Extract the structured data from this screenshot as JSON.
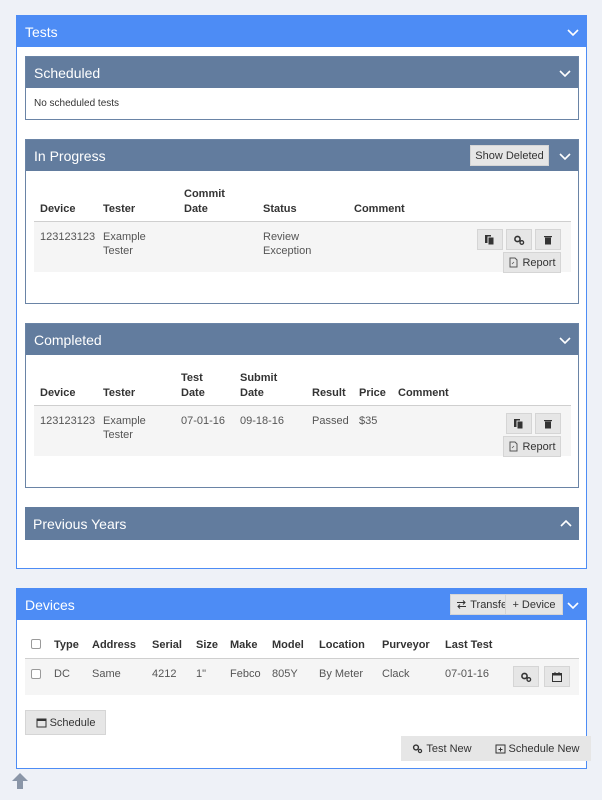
{
  "tests": {
    "title": "Tests",
    "scheduled": {
      "title": "Scheduled",
      "empty_text": "No scheduled tests"
    },
    "in_progress": {
      "title": "In Progress",
      "show_deleted_label": "Show Deleted",
      "headers": [
        "Device",
        "Tester",
        "Commit Date",
        "Status",
        "Comment"
      ],
      "header_commit_line1": "Commit",
      "header_commit_line2": "Date",
      "rows": [
        {
          "device": "123123123",
          "tester_line1": "Example",
          "tester_line2": "Tester",
          "commit_date": "",
          "status_line1": "Review",
          "status_line2": "Exception",
          "comment": "",
          "report_label": "Report"
        }
      ]
    },
    "completed": {
      "title": "Completed",
      "headers": [
        "Device",
        "Tester",
        "Test Date",
        "Submit Date",
        "Result",
        "Price",
        "Comment"
      ],
      "header_test_line1": "Test",
      "header_test_line2": "Date",
      "header_submit_line1": "Submit",
      "header_submit_line2": "Date",
      "rows": [
        {
          "device": "123123123",
          "tester_line1": "Example",
          "tester_line2": "Tester",
          "test_date": "07-01-16",
          "submit_date": "09-18-16",
          "result": "Passed",
          "price": "$35",
          "comment": "",
          "report_label": "Report"
        }
      ]
    },
    "previous_years": {
      "title": "Previous Years"
    }
  },
  "devices": {
    "title": "Devices",
    "transfer_label": "Transfer",
    "add_device_label": "+ Device",
    "headers": [
      "Type",
      "Address",
      "Serial",
      "Size",
      "Make",
      "Model",
      "Location",
      "Purveyor",
      "Last Test"
    ],
    "rows": [
      {
        "type": "DC",
        "address": "Same",
        "serial": "4212",
        "size": "1\"",
        "make": "Febco",
        "model": "805Y",
        "location": "By Meter",
        "purveyor": "Clack",
        "last_test": "07-01-16"
      }
    ],
    "schedule_label": "Schedule",
    "test_new_label": "Test New",
    "schedule_new_label": "Schedule New"
  },
  "colors": {
    "primary": "#4d8cf5",
    "section_header": "#627c9e",
    "background": "#eef1f7"
  }
}
